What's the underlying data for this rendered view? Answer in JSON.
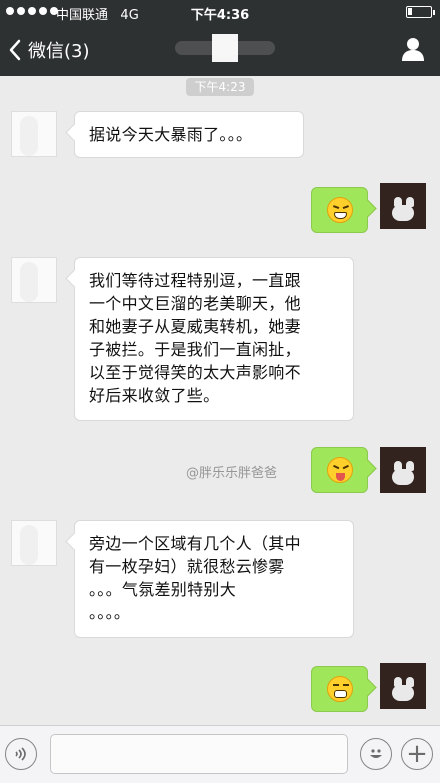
{
  "status_bar": {
    "carrier": "中国联通",
    "network": "4G",
    "time": "下午4:36"
  },
  "nav": {
    "back_label": "微信(3)"
  },
  "chat": {
    "timestamp": "下午4:23",
    "messages": [
      {
        "side": "left",
        "type": "text",
        "text": "据说今天大暴雨了。。。"
      },
      {
        "side": "right",
        "type": "emoji",
        "emoji": "grimace-emoji"
      },
      {
        "side": "left",
        "type": "text",
        "lines": [
          "我们等待过程特别逗，一直跟",
          "一个中文巨溜的老美聊天，他",
          "和她妻子从夏威夷转机，她妻",
          "子被拦。于是我们一直闲扯，",
          "以至于觉得笑的太大声影响不",
          "好后来收敛了些。"
        ]
      },
      {
        "side": "right",
        "type": "emoji",
        "emoji": "laughing-tongue-emoji"
      },
      {
        "side": "left",
        "type": "text",
        "lines": [
          "旁边一个区域有几个人（其中",
          "有一枚孕妇）就很愁云惨雾",
          "。。。气氛差别特别大",
          "。。。。"
        ]
      },
      {
        "side": "right",
        "type": "emoji",
        "emoji": "grinning-teeth-emoji"
      }
    ],
    "watermark": "@胖乐乐胖爸爸"
  },
  "input_bar": {
    "voice_icon": "voice-icon",
    "emoji_icon": "smiley-icon",
    "plus_label": "+"
  },
  "colors": {
    "nav_bg": "#2e3132",
    "chat_bg": "#ebebeb",
    "my_bubble": "#9fe65a",
    "their_bubble": "#ffffff"
  }
}
